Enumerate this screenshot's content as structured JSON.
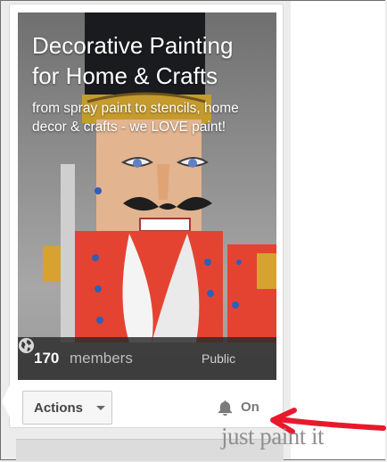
{
  "community": {
    "title": "Decorative Painting for Home & Crafts",
    "subtitle": "from spray paint to stencils, home decor & crafts - we LOVE paint!",
    "member_count": "170",
    "members_label": "members",
    "visibility": "Public",
    "visibility_icon": "globe-icon"
  },
  "actions": {
    "label": "Actions",
    "icon": "chevron-down-icon"
  },
  "notifications": {
    "icon": "bell-icon",
    "state": "On"
  },
  "watermark": {
    "text": "just paint it",
    "arrow_color": "#e8192c"
  }
}
